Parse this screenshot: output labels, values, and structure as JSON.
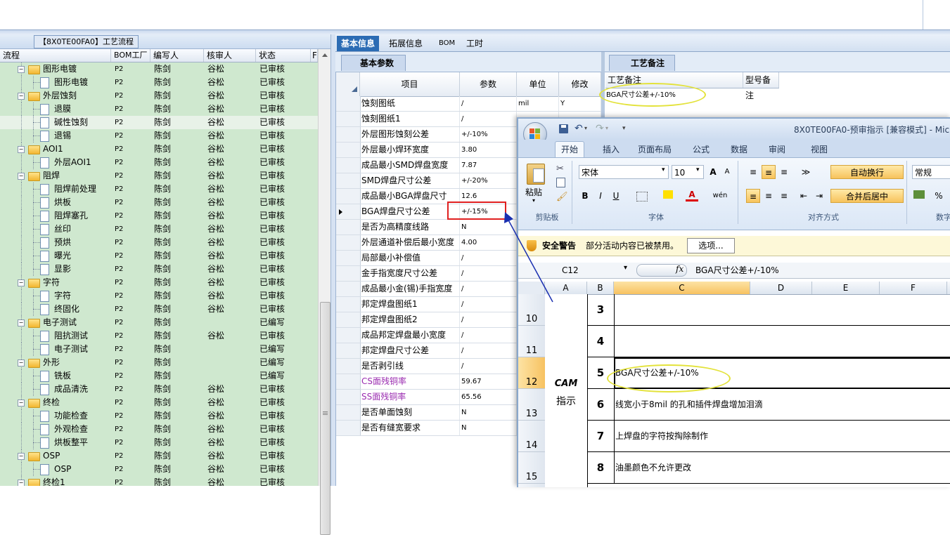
{
  "left_panel": {
    "title": "【8X0TE00FA0】工艺流程",
    "columns": [
      "流程",
      "BOM工厂",
      "编写人",
      "核审人",
      "状态",
      "F"
    ],
    "rows": [
      {
        "name": "图形电镀",
        "type": "folder",
        "factory": "P2",
        "writer": "陈剑",
        "reviewer": "谷松",
        "status": "已审核"
      },
      {
        "name": "图形电镀",
        "type": "doc",
        "factory": "P2",
        "writer": "陈剑",
        "reviewer": "谷松",
        "status": "已审核"
      },
      {
        "name": "外层蚀刻",
        "type": "folder",
        "factory": "P2",
        "writer": "陈剑",
        "reviewer": "谷松",
        "status": "已审核"
      },
      {
        "name": "退膜",
        "type": "doc",
        "factory": "P2",
        "writer": "陈剑",
        "reviewer": "谷松",
        "status": "已审核"
      },
      {
        "name": "碱性蚀刻",
        "type": "doc",
        "factory": "P2",
        "writer": "陈剑",
        "reviewer": "谷松",
        "status": "已审核"
      },
      {
        "name": "退锡",
        "type": "doc",
        "factory": "P2",
        "writer": "陈剑",
        "reviewer": "谷松",
        "status": "已审核"
      },
      {
        "name": "AOI1",
        "type": "folder",
        "factory": "P2",
        "writer": "陈剑",
        "reviewer": "谷松",
        "status": "已审核"
      },
      {
        "name": "外层AOI1",
        "type": "doc",
        "factory": "P2",
        "writer": "陈剑",
        "reviewer": "谷松",
        "status": "已审核"
      },
      {
        "name": "阻焊",
        "type": "folder",
        "factory": "P2",
        "writer": "陈剑",
        "reviewer": "谷松",
        "status": "已审核"
      },
      {
        "name": "阻焊前处理",
        "type": "doc",
        "factory": "P2",
        "writer": "陈剑",
        "reviewer": "谷松",
        "status": "已审核"
      },
      {
        "name": "烘板",
        "type": "doc",
        "factory": "P2",
        "writer": "陈剑",
        "reviewer": "谷松",
        "status": "已审核"
      },
      {
        "name": "阻焊塞孔",
        "type": "doc",
        "factory": "P2",
        "writer": "陈剑",
        "reviewer": "谷松",
        "status": "已审核"
      },
      {
        "name": "丝印",
        "type": "doc",
        "factory": "P2",
        "writer": "陈剑",
        "reviewer": "谷松",
        "status": "已审核"
      },
      {
        "name": "预烘",
        "type": "doc",
        "factory": "P2",
        "writer": "陈剑",
        "reviewer": "谷松",
        "status": "已审核"
      },
      {
        "name": "曝光",
        "type": "doc",
        "factory": "P2",
        "writer": "陈剑",
        "reviewer": "谷松",
        "status": "已审核"
      },
      {
        "name": "显影",
        "type": "doc",
        "factory": "P2",
        "writer": "陈剑",
        "reviewer": "谷松",
        "status": "已审核"
      },
      {
        "name": "字符",
        "type": "folder",
        "factory": "P2",
        "writer": "陈剑",
        "reviewer": "谷松",
        "status": "已审核"
      },
      {
        "name": "字符",
        "type": "doc",
        "factory": "P2",
        "writer": "陈剑",
        "reviewer": "谷松",
        "status": "已审核"
      },
      {
        "name": "终固化",
        "type": "doc",
        "factory": "P2",
        "writer": "陈剑",
        "reviewer": "谷松",
        "status": "已审核"
      },
      {
        "name": "电子测试",
        "type": "folder",
        "factory": "P2",
        "writer": "陈剑",
        "reviewer": "",
        "status": "已编写"
      },
      {
        "name": "阻抗测试",
        "type": "doc",
        "factory": "P2",
        "writer": "陈剑",
        "reviewer": "谷松",
        "status": "已审核"
      },
      {
        "name": "电子测试",
        "type": "doc",
        "factory": "P2",
        "writer": "陈剑",
        "reviewer": "",
        "status": "已编写"
      },
      {
        "name": "外形",
        "type": "folder",
        "factory": "P2",
        "writer": "陈剑",
        "reviewer": "",
        "status": "已编写"
      },
      {
        "name": "铣板",
        "type": "doc",
        "factory": "P2",
        "writer": "陈剑",
        "reviewer": "",
        "status": "已编写"
      },
      {
        "name": "成品清洗",
        "type": "doc",
        "factory": "P2",
        "writer": "陈剑",
        "reviewer": "谷松",
        "status": "已审核"
      },
      {
        "name": "终检",
        "type": "folder",
        "factory": "P2",
        "writer": "陈剑",
        "reviewer": "谷松",
        "status": "已审核"
      },
      {
        "name": "功能检查",
        "type": "doc",
        "factory": "P2",
        "writer": "陈剑",
        "reviewer": "谷松",
        "status": "已审核"
      },
      {
        "name": "外观检查",
        "type": "doc",
        "factory": "P2",
        "writer": "陈剑",
        "reviewer": "谷松",
        "status": "已审核"
      },
      {
        "name": "烘板整平",
        "type": "doc",
        "factory": "P2",
        "writer": "陈剑",
        "reviewer": "谷松",
        "status": "已审核"
      },
      {
        "name": "OSP",
        "type": "folder",
        "factory": "P2",
        "writer": "陈剑",
        "reviewer": "谷松",
        "status": "已审核"
      },
      {
        "name": "OSP",
        "type": "doc",
        "factory": "P2",
        "writer": "陈剑",
        "reviewer": "谷松",
        "status": "已审核"
      },
      {
        "name": "终检1",
        "type": "folder",
        "factory": "P2",
        "writer": "陈剑",
        "reviewer": "谷松",
        "status": "已审核"
      }
    ],
    "selected_row": 4
  },
  "main_tabs": [
    "基本信息",
    "拓展信息",
    "BOM",
    "工时"
  ],
  "param_panel": {
    "tab_label": "基本参数",
    "columns": [
      "项目",
      "参数",
      "单位",
      "修改"
    ],
    "rows": [
      {
        "item": "蚀刻图纸",
        "value": "/",
        "unit": "mil",
        "mod": "Y"
      },
      {
        "item": "蚀刻图纸1",
        "value": "/",
        "unit": "",
        "mod": ""
      },
      {
        "item": "外层图形蚀刻公差",
        "value": "+/-10%",
        "unit": "",
        "mod": ""
      },
      {
        "item": "外层最小焊环宽度",
        "value": "3.80",
        "unit": "",
        "mod": ""
      },
      {
        "item": "成品最小SMD焊盘宽度",
        "value": "7.87",
        "unit": "",
        "mod": ""
      },
      {
        "item": "SMD焊盘尺寸公差",
        "value": "+/-20%",
        "unit": "",
        "mod": ""
      },
      {
        "item": "成品最小BGA焊盘尺寸",
        "value": "12.6",
        "unit": "",
        "mod": ""
      },
      {
        "item": "BGA焊盘尺寸公差",
        "value": "+/-15%",
        "unit": "",
        "mod": ""
      },
      {
        "item": "是否为高精度线路",
        "value": "N",
        "unit": "",
        "mod": ""
      },
      {
        "item": "外层通道补偿后最小宽度",
        "value": "4.00",
        "unit": "",
        "mod": ""
      },
      {
        "item": "局部最小补偿值",
        "value": "/",
        "unit": "",
        "mod": ""
      },
      {
        "item": "金手指宽度尺寸公差",
        "value": "/",
        "unit": "",
        "mod": ""
      },
      {
        "item": "成品最小金(锡)手指宽度",
        "value": "/",
        "unit": "",
        "mod": ""
      },
      {
        "item": "邦定焊盘图纸1",
        "value": "/",
        "unit": "",
        "mod": ""
      },
      {
        "item": "邦定焊盘图纸2",
        "value": "/",
        "unit": "",
        "mod": ""
      },
      {
        "item": "成品邦定焊盘最小宽度",
        "value": "/",
        "unit": "",
        "mod": ""
      },
      {
        "item": "邦定焊盘尺寸公差",
        "value": "/",
        "unit": "",
        "mod": ""
      },
      {
        "item": "是否剥引线",
        "value": "/",
        "unit": "",
        "mod": ""
      },
      {
        "item": "CS面残铜率",
        "value": "59.67",
        "unit": "",
        "mod": "",
        "purple": true
      },
      {
        "item": "SS面残铜率",
        "value": "65.56",
        "unit": "",
        "mod": "",
        "purple": true
      },
      {
        "item": "是否单面蚀刻",
        "value": "N",
        "unit": "",
        "mod": ""
      },
      {
        "item": "是否有缝宽要求",
        "value": "N",
        "unit": "",
        "mod": ""
      }
    ],
    "current_row": 7
  },
  "notes_panel": {
    "tab_label": "工艺备注",
    "columns": [
      "工艺备注",
      "型号备注"
    ],
    "value": "BGA尺寸公差+/-10%"
  },
  "excel": {
    "title": "8X0TE00FA0-预审指示 [兼容模式] - Mic",
    "tabs": [
      "开始",
      "插入",
      "页面布局",
      "公式",
      "数据",
      "审阅",
      "视图"
    ],
    "active_tab": 0,
    "font_name": "宋体",
    "font_size": "10",
    "number_format": "常规",
    "buttons": {
      "paste": "粘贴",
      "wrap": "自动换行",
      "merge": "合并后居中",
      "bold": "B",
      "italic": "I",
      "underline": "U",
      "percent": "%",
      "font_grow": "A",
      "font_shrink": "A",
      "font_color": "A",
      "phonetic": "wén"
    },
    "groups": [
      "剪贴板",
      "字体",
      "对齐方式",
      "数字"
    ],
    "security": {
      "title": "安全警告",
      "message": "部分活动内容已被禁用。",
      "button": "选项..."
    },
    "cell_ref": "C12",
    "fx": "fx",
    "formula": "BGA尺寸公差+/-10%",
    "columns": [
      "A",
      "B",
      "C",
      "D",
      "E",
      "F"
    ],
    "selected_column": "C",
    "row_numbers": [
      "10",
      "11",
      "12",
      "13",
      "14",
      "15"
    ],
    "selected_row_number": "12",
    "cam_label": "CAM",
    "cam_sub": "指示",
    "cells": [
      {
        "num": "3",
        "text": ""
      },
      {
        "num": "4",
        "text": ""
      },
      {
        "num": "5",
        "text": "BGA尺寸公差+/-10%"
      },
      {
        "num": "6",
        "text": "线宽小于8mil 的孔和插件焊盘增加泪滴"
      },
      {
        "num": "7",
        "text": "上焊盘的字符按掏除制作"
      },
      {
        "num": "8",
        "text": "油墨颜色不允许更改"
      }
    ]
  },
  "colors": {
    "tree_bg": "#cfe8cf",
    "accent": "#2c6cb4",
    "highlight_box": "#e02020",
    "ellipse": "#e3e23a",
    "arrow": "#1a2fb0"
  }
}
